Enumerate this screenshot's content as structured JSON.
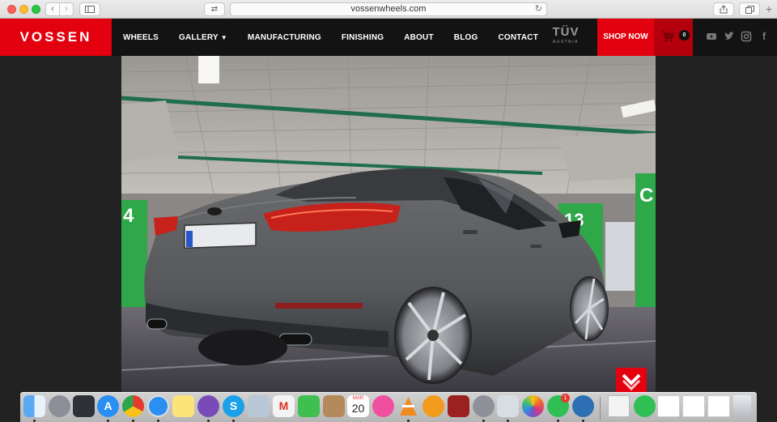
{
  "browser": {
    "url": "vossenwheels.com"
  },
  "site": {
    "logo_text": "VOSSEN",
    "menu": [
      {
        "label": "WHEELS"
      },
      {
        "label": "GALLERY"
      },
      {
        "label": "MANUFACTURING"
      },
      {
        "label": "FINISHING"
      },
      {
        "label": "ABOUT"
      },
      {
        "label": "BLOG"
      },
      {
        "label": "CONTACT"
      }
    ],
    "certification": {
      "main": "TÜV",
      "sub": "AUSTRIA"
    },
    "shop_label": "SHOP NOW",
    "cart_count": "0",
    "colors": {
      "brand_red": "#e3000f",
      "dark_red": "#b4000c",
      "nav_bg": "#131313"
    }
  },
  "gallery": {
    "pillar_labels": [
      "4",
      "13",
      "C"
    ]
  },
  "dock": {
    "calendar_month": "MAR",
    "calendar_day": "20",
    "notification_badge": "1",
    "apps": [
      "finder-icon",
      "launchpad-icon",
      "mission-control-icon",
      "app-store-icon",
      "chrome-icon",
      "safari-icon",
      "notes-icon",
      "viber-icon",
      "skype-icon",
      "preview-icon",
      "gmail-icon",
      "facetime-icon",
      "contacts-icon",
      "calendar-icon",
      "itunes-icon",
      "vlc-icon",
      "ibooks-icon",
      "photo-booth-icon",
      "system-preferences-icon",
      "image-capture-icon",
      "photos-icon",
      "whatsapp-icon",
      "utility-icon"
    ]
  }
}
